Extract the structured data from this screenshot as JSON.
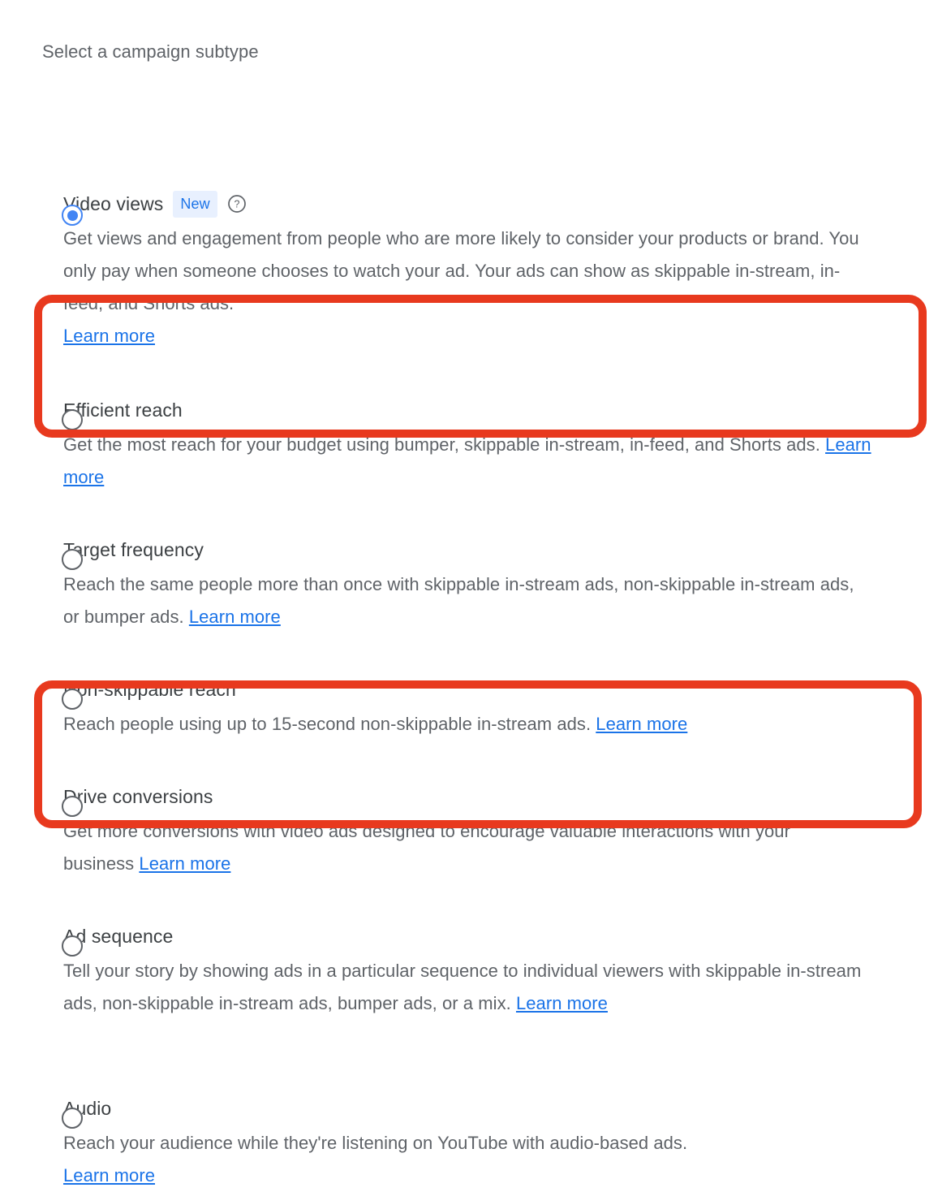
{
  "section": {
    "title": "Select a campaign subtype"
  },
  "colors": {
    "annotation_red": "#e8391e",
    "link_blue": "#1a73e8",
    "radio_selected_blue": "#4285f4",
    "badge_bg": "#e8f0fe",
    "label_gray": "#3c4043",
    "text_gray": "#5f6368"
  },
  "learn_more_label": "Learn more",
  "options": [
    {
      "id": "video-views",
      "label": "Video views",
      "selected": true,
      "badge": "New",
      "has_help_icon": true,
      "description": "Get views and engagement from people who are more likely to consider your products or brand. You only pay when someone chooses to watch your ad. Your ads can show as skippable in-stream, in-feed, and Shorts ads.",
      "link_label": "Learn more",
      "link_on_new_line": true,
      "highlighted": false
    },
    {
      "id": "efficient-reach",
      "label": "Efficient reach",
      "selected": false,
      "badge": null,
      "has_help_icon": false,
      "description": "Get the most reach for your budget using bumper, skippable in-stream, in-feed, and Shorts ads.",
      "link_label": "Learn more",
      "link_on_new_line": false,
      "highlighted": true
    },
    {
      "id": "target-frequency",
      "label": "Target frequency",
      "selected": false,
      "badge": null,
      "has_help_icon": false,
      "description": "Reach the same people more than once with skippable in-stream ads, non-skippable in-stream ads, or bumper ads.",
      "link_label": "Learn more",
      "link_on_new_line": false,
      "highlighted": false
    },
    {
      "id": "non-skippable-reach",
      "label": "Non-skippable reach",
      "selected": false,
      "badge": null,
      "has_help_icon": false,
      "description": "Reach people using up to 15-second non-skippable in-stream ads.",
      "link_label": "Learn more",
      "link_on_new_line": false,
      "highlighted": false
    },
    {
      "id": "drive-conversions",
      "label": "Drive conversions",
      "selected": false,
      "badge": null,
      "has_help_icon": false,
      "description": "Get more conversions with video ads designed to encourage valuable interactions with your business",
      "link_label": "Learn more",
      "link_on_new_line": false,
      "highlighted": true
    },
    {
      "id": "ad-sequence",
      "label": "Ad sequence",
      "selected": false,
      "badge": null,
      "has_help_icon": false,
      "description": "Tell your story by showing ads in a particular sequence to individual viewers with skippable in-stream ads, non-skippable in-stream ads, bumper ads, or a mix.",
      "link_label": "Learn more",
      "link_on_new_line": false,
      "highlighted": false
    },
    {
      "id": "audio",
      "label": "Audio",
      "selected": false,
      "badge": null,
      "has_help_icon": false,
      "description": "Reach your audience while they're listening on YouTube with audio-based ads.",
      "link_label": "Learn more",
      "link_on_new_line": true,
      "highlighted": false
    }
  ]
}
